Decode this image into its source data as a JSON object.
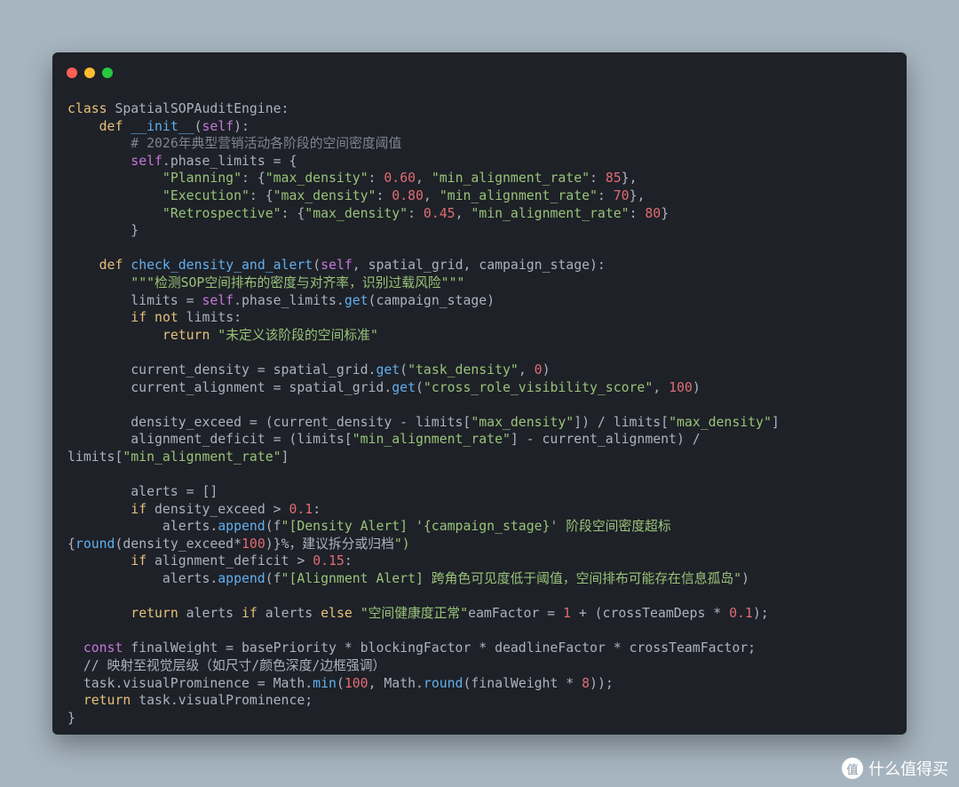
{
  "window": {
    "lines": [
      "class SpatialSOPAuditEngine:",
      "    def __init__(self):",
      "        # 2026年典型营销活动各阶段的空间密度阈值",
      "        self.phase_limits = {",
      "            \"Planning\": {\"max_density\": 0.60, \"min_alignment_rate\": 85},",
      "            \"Execution\": {\"max_density\": 0.80, \"min_alignment_rate\": 70},",
      "            \"Retrospective\": {\"max_density\": 0.45, \"min_alignment_rate\": 80}",
      "        }",
      "",
      "    def check_density_and_alert(self, spatial_grid, campaign_stage):",
      "        \"\"\"检测SOP空间排布的密度与对齐率，识别过载风险\"\"\"",
      "        limits = self.phase_limits.get(campaign_stage)",
      "        if not limits:",
      "            return \"未定义该阶段的空间标准\"",
      "",
      "        current_density = spatial_grid.get(\"task_density\", 0)",
      "        current_alignment = spatial_grid.get(\"cross_role_visibility_score\", 100)",
      "",
      "        density_exceed = (current_density - limits[\"max_density\"]) / limits[\"max_density\"]",
      "        alignment_deficit = (limits[\"min_alignment_rate\"] - current_alignment) /",
      "limits[\"min_alignment_rate\"]",
      "",
      "        alerts = []",
      "        if density_exceed > 0.1:",
      "            alerts.append(f\"[Density Alert] '{campaign_stage}' 阶段空间密度超标",
      "{round(density_exceed*100)}%，建议拆分或归档\")",
      "        if alignment_deficit > 0.15:",
      "            alerts.append(f\"[Alignment Alert] 跨角色可见度低于阈值，空间排布可能存在信息孤岛\")",
      "",
      "        return alerts if alerts else \"空间健康度正常\"eamFactor = 1 + (crossTeamDeps * 0.1);",
      "",
      "  const finalWeight = basePriority * blockingFactor * deadlineFactor * crossTeamFactor;",
      "  // 映射至视觉层级（如尺寸/颜色深度/边框强调）",
      "  task.visualProminence = Math.min(100, Math.round(finalWeight * 8));",
      "  return task.visualProminence;",
      "}"
    ]
  },
  "watermark": {
    "logo_text": "值",
    "text": "什么值得买"
  },
  "colors": {
    "background": "#a7b5c0",
    "editor_bg": "#1e2127",
    "keyword": "#e5c07b",
    "self": "#c678dd",
    "function": "#61afef",
    "string": "#98c379",
    "number": "#e06c75",
    "comment": "#7f848e"
  }
}
